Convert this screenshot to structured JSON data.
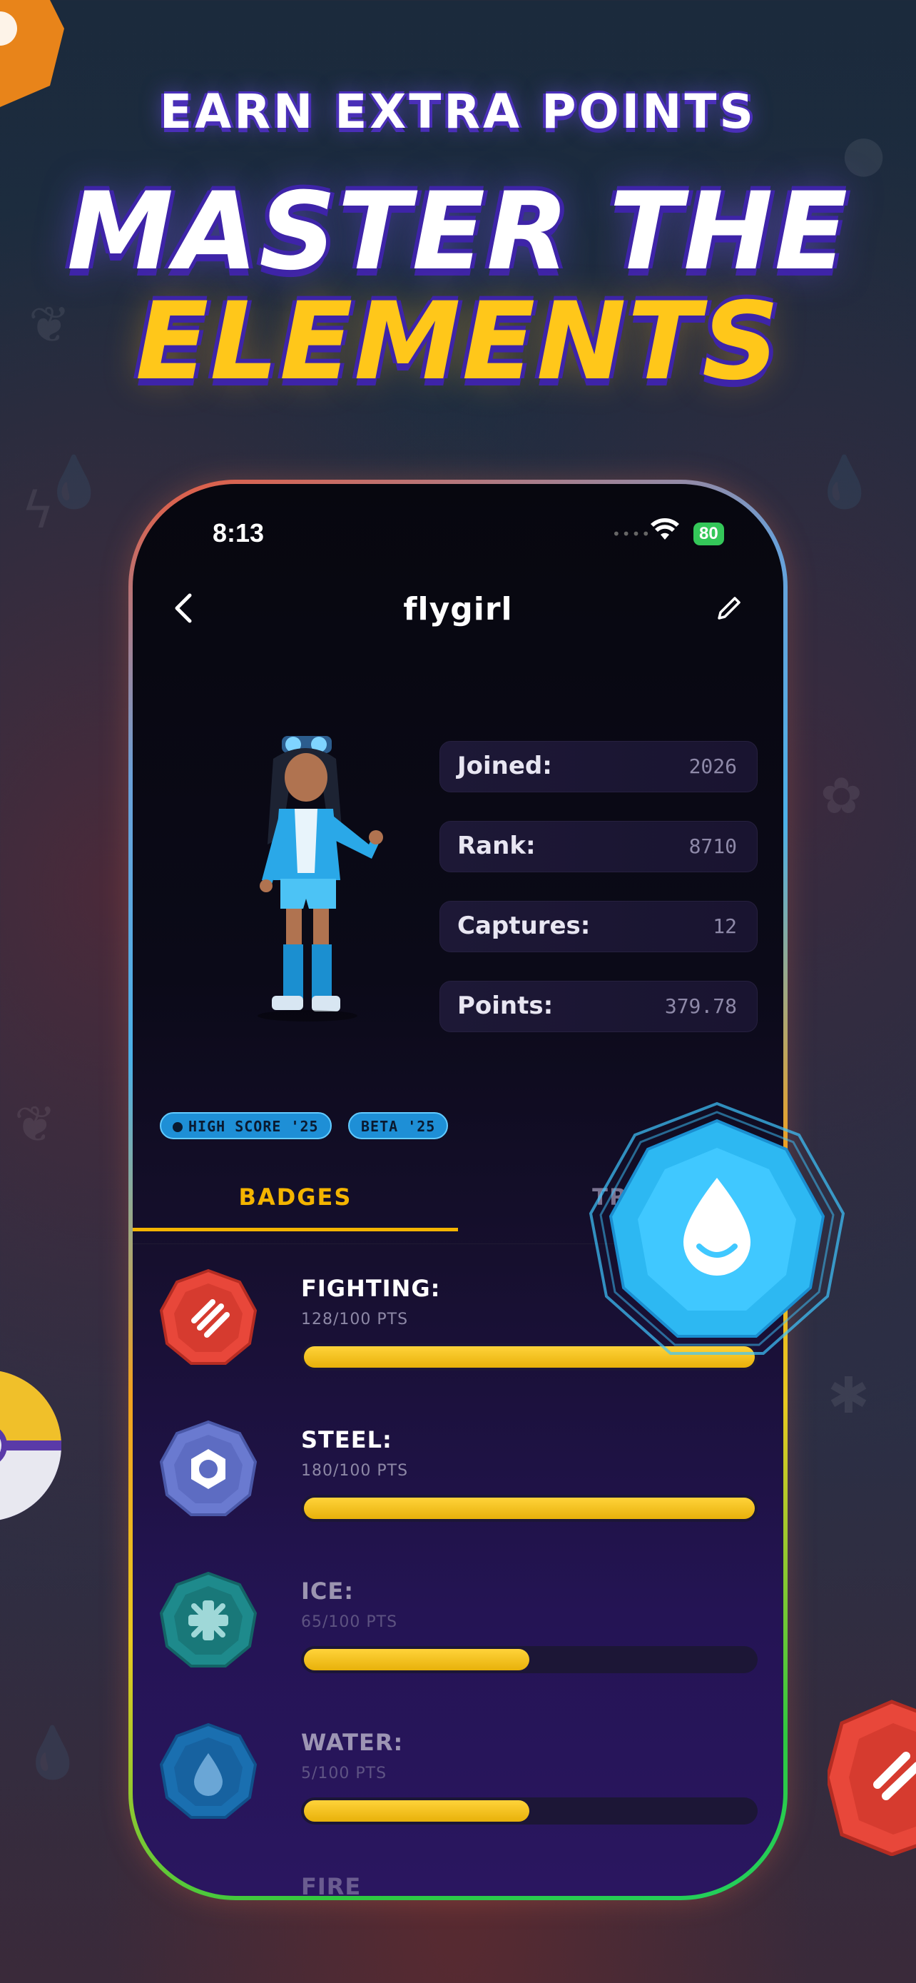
{
  "promo": {
    "eyebrow": "EARN EXTRA POINTS",
    "title_line1": "MASTER THE",
    "title_line2": "ELEMENTS"
  },
  "status_bar": {
    "time": "8:13",
    "battery": "80"
  },
  "nav": {
    "username": "flygirl"
  },
  "stats": [
    {
      "label": "Joined:",
      "value": "2026"
    },
    {
      "label": "Rank:",
      "value": "8710"
    },
    {
      "label": "Captures:",
      "value": "12"
    },
    {
      "label": "Points:",
      "value": "379.78"
    }
  ],
  "tags": [
    "HIGH SCORE '25",
    "BETA '25"
  ],
  "tabs": [
    "BADGES",
    "TRO"
  ],
  "badges": [
    {
      "name": "FIGHTING:",
      "points": "128/100 PTS",
      "progress": 1.0,
      "color": "#e8473a",
      "icon": "fist-icon"
    },
    {
      "name": "STEEL:",
      "points": "180/100 PTS",
      "progress": 1.0,
      "color": "#6a7ad0",
      "icon": "hexnut-icon"
    },
    {
      "name": "ICE:",
      "points": "65/100 PTS",
      "progress": 0.5,
      "color": "#1e8a8c",
      "icon": "snowflake-icon"
    },
    {
      "name": "WATER:",
      "points": "5/100 PTS",
      "progress": 0.5,
      "color": "#1a7fc2",
      "icon": "drop-icon"
    }
  ],
  "peek_label": "FIRE",
  "colors": {
    "accent": "#f4b400",
    "water_gem": "#35c6ff",
    "tag_bg": "#1e8fd6"
  }
}
